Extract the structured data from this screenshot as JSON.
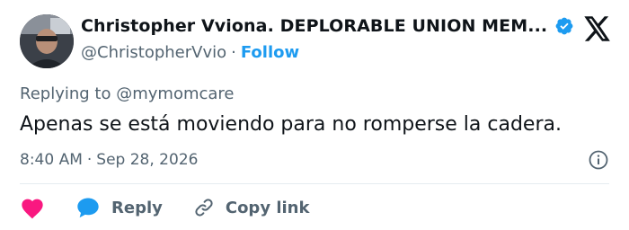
{
  "author": {
    "display_name": "Christopher Vviona. DEPLORABLE UNION MEM...",
    "handle": "@ChristopherVvio",
    "separator": "·",
    "follow_label": "Follow"
  },
  "reply": {
    "prefix": "Replying to",
    "target": "@mymomcare"
  },
  "tweet": {
    "text": "Apenas se está moviendo para no romperse la cadera.",
    "time": "8:40 AM",
    "date_separator": "·",
    "date": "Sep 28, 2026"
  },
  "actions": {
    "reply_label": "Reply",
    "copy_label": "Copy link"
  },
  "colors": {
    "accent": "#1d9bf0",
    "like": "#f91880",
    "muted": "#536471",
    "text": "#0f1419"
  },
  "icons": [
    "verified-badge-icon",
    "x-logo-icon",
    "info-icon",
    "heart-icon",
    "reply-bubble-icon",
    "link-icon"
  ]
}
